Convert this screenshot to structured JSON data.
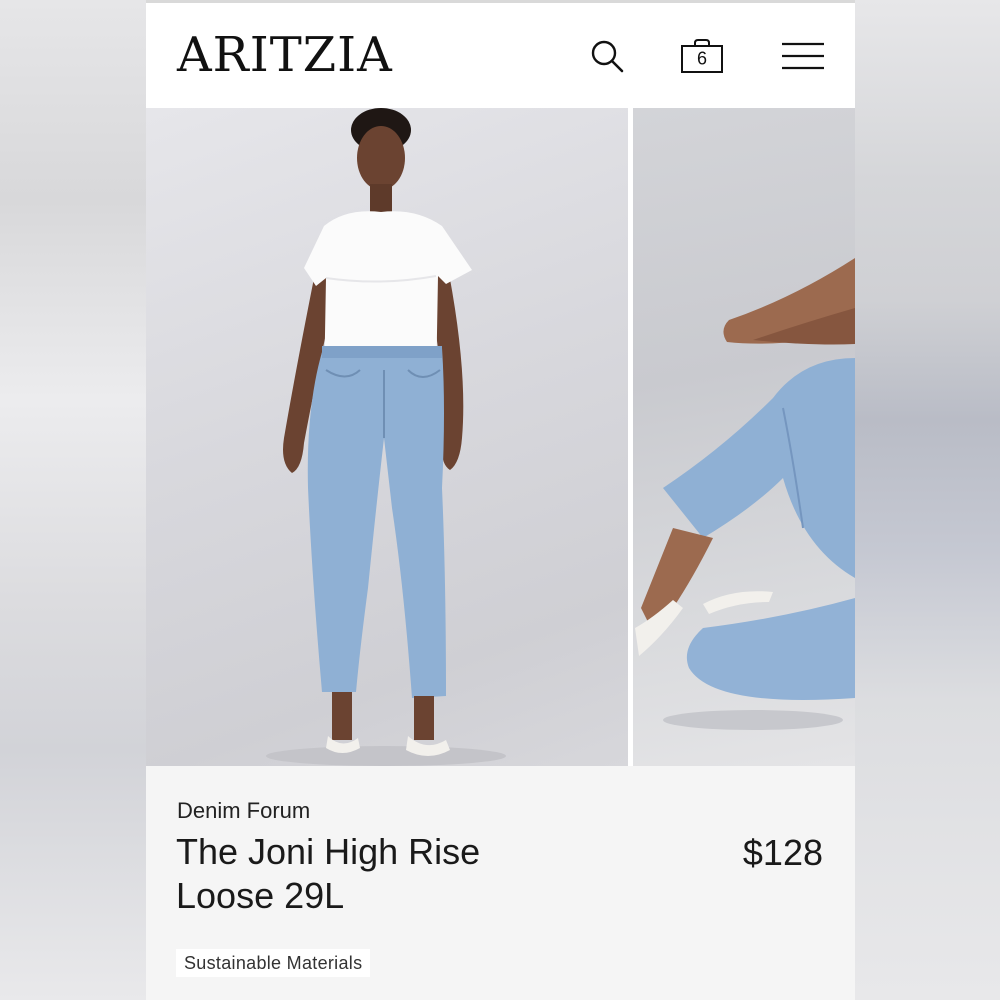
{
  "header": {
    "logo_text": "ARITZIA",
    "bag_count": "6",
    "icons": {
      "search": "search-icon",
      "bag": "shopping-bag-icon",
      "menu": "hamburger-menu-icon"
    }
  },
  "gallery": {
    "images": [
      {
        "subject": "model-full-body-front"
      },
      {
        "subject": "model-seated-legs-closeup"
      }
    ]
  },
  "product": {
    "brand": "Denim Forum",
    "name": "The Joni High Rise Loose 29L",
    "price": "$128",
    "tag": "Sustainable Materials"
  },
  "colors": {
    "text": "#1a1a1a",
    "background": "#f5f5f5",
    "header_bg": "#ffffff",
    "denim": "#8fb0d4"
  }
}
